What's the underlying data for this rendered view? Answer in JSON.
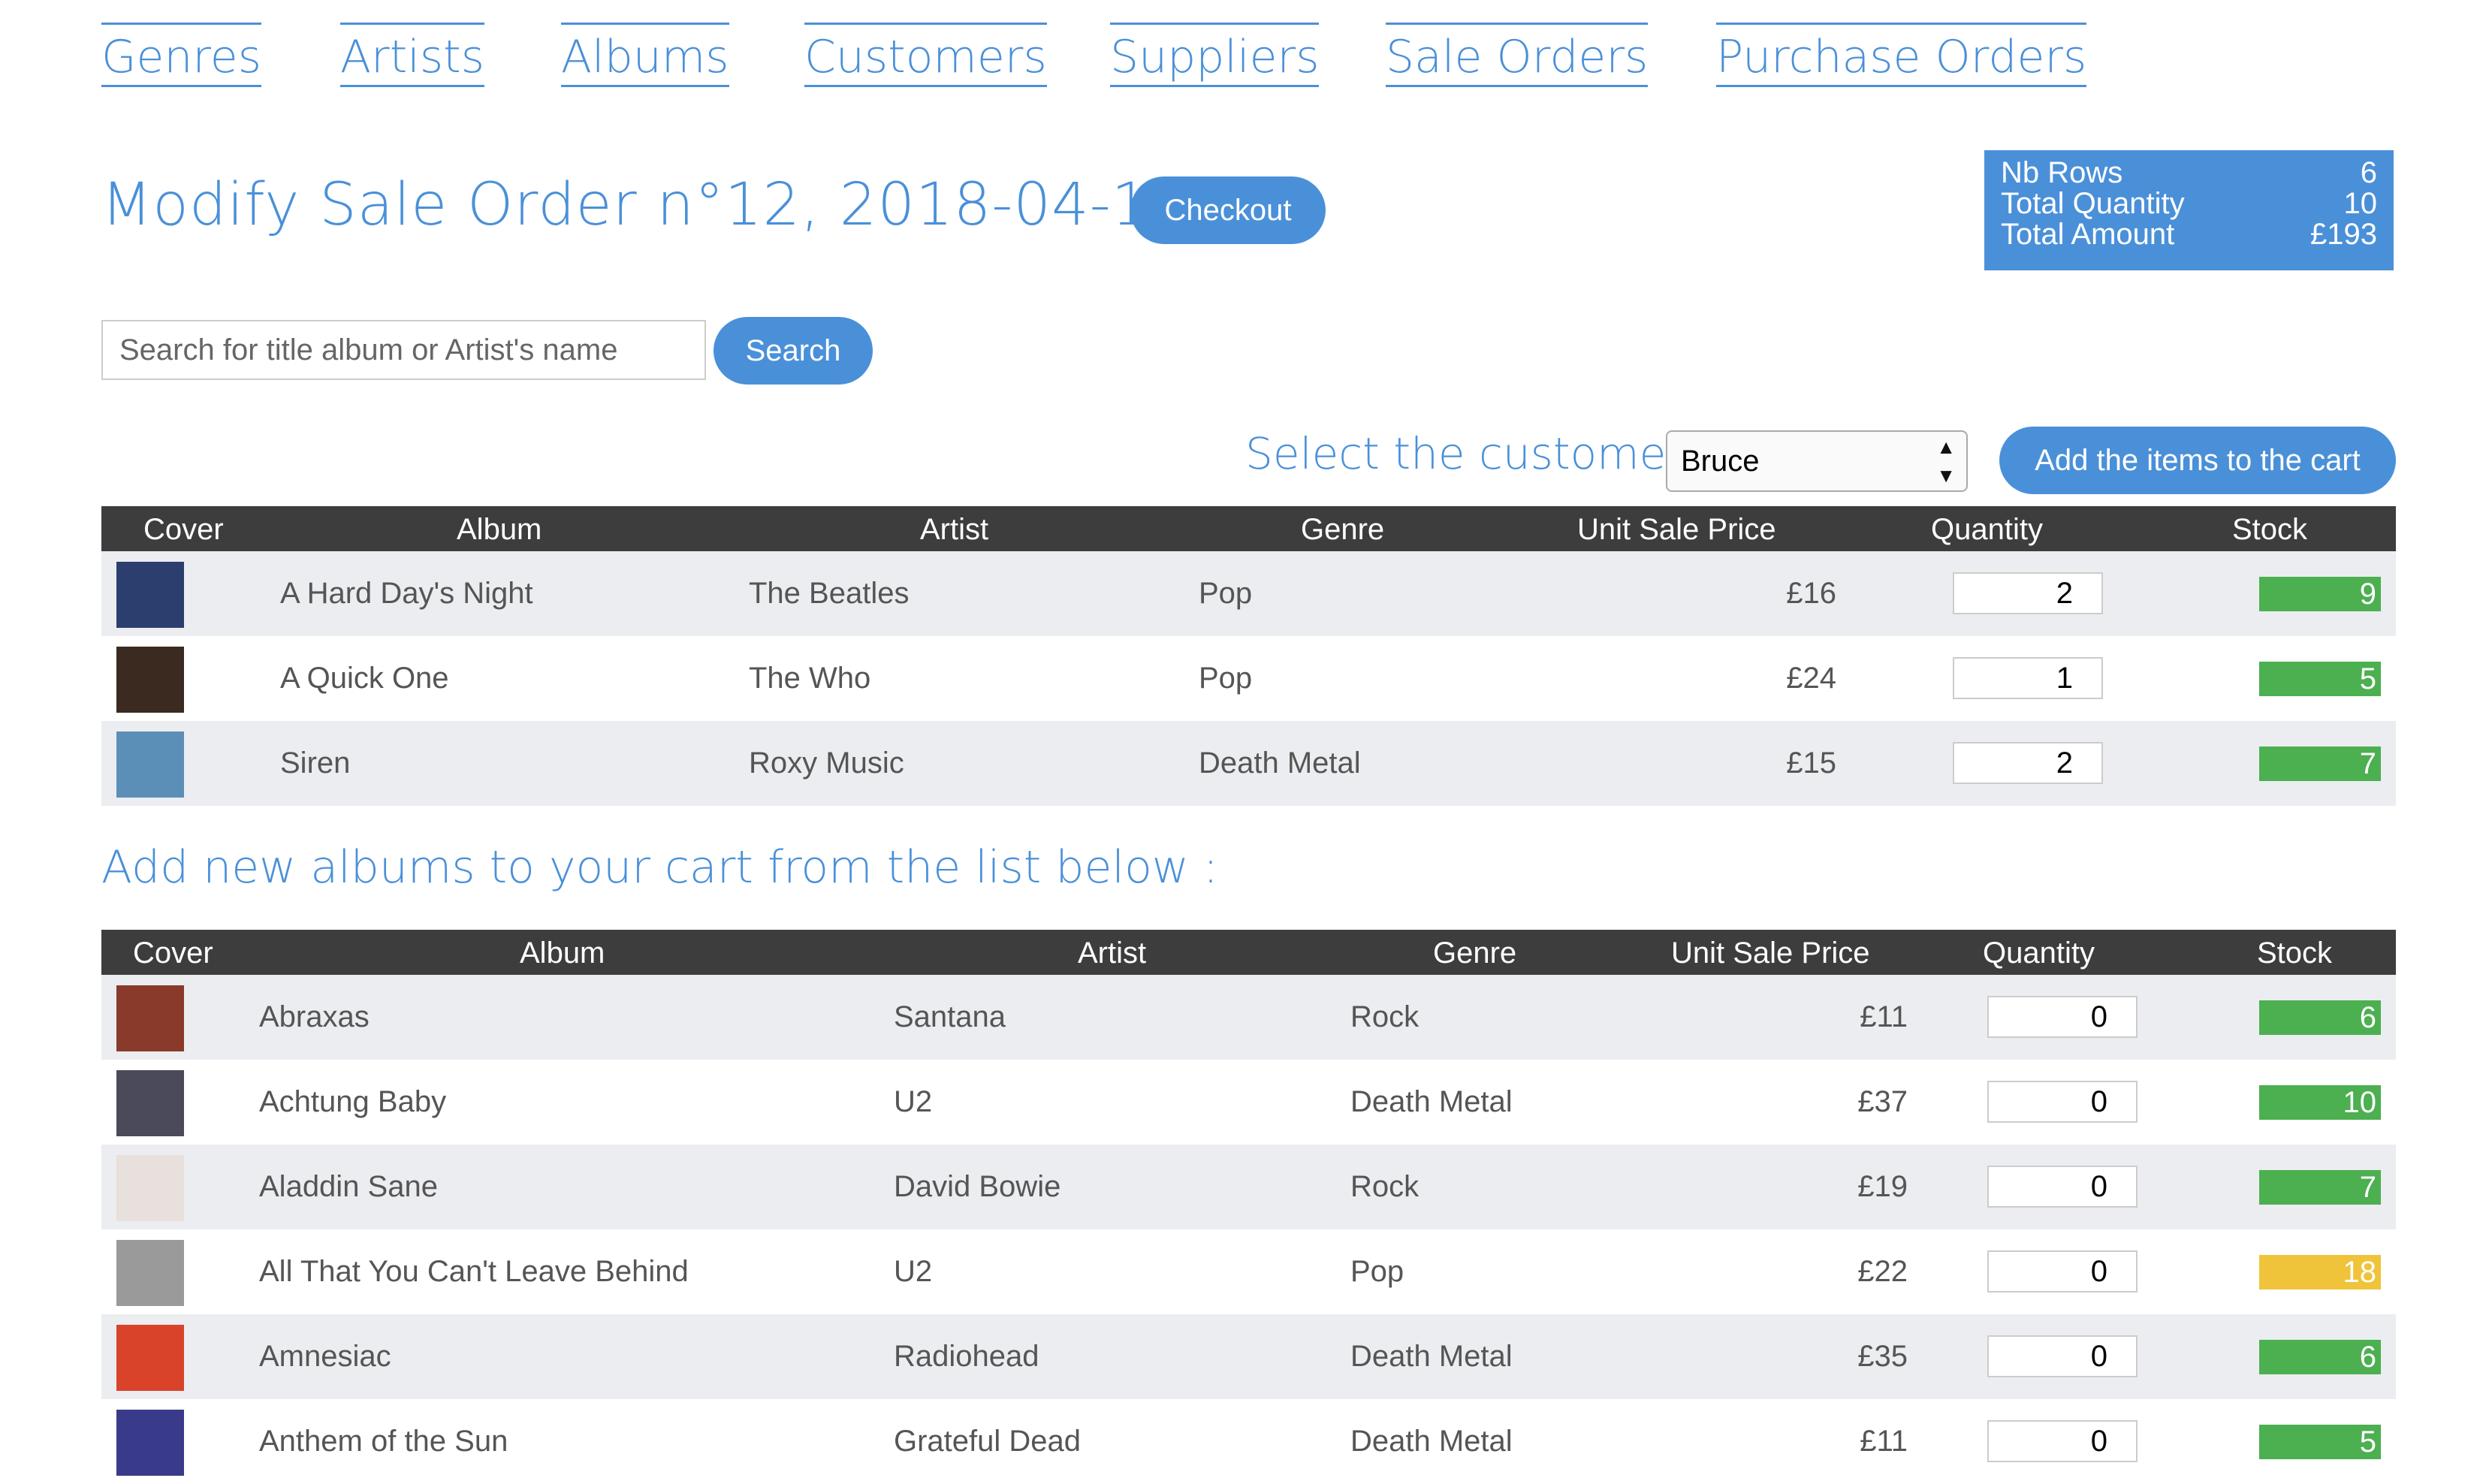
{
  "nav": [
    "Genres",
    "Artists",
    "Albums",
    "Customers",
    "Suppliers",
    "Sale Orders",
    "Purchase Orders"
  ],
  "title": "Modify Sale Order n°12, 2018-04-12",
  "checkout_label": "Checkout",
  "summary": {
    "rows": [
      {
        "label": "Nb Rows",
        "value": "6"
      },
      {
        "label": "Total Quantity",
        "value": "10"
      },
      {
        "label": "Total Amount",
        "value": "£193"
      }
    ]
  },
  "search": {
    "placeholder": "Search for title album or Artist's name",
    "button": "Search"
  },
  "customer": {
    "label": "Select the customer :",
    "selected": "Bruce",
    "add_button": "Add the items to the cart"
  },
  "columns": [
    "Cover",
    "Album",
    "Artist",
    "Genre",
    "Unit Sale Price",
    "Quantity",
    "Stock"
  ],
  "colors": {
    "accent": "#4a90d9",
    "header_bg": "#3d3d3d",
    "stock_ok": "#4caf50",
    "stock_warn": "#f0c43a"
  },
  "cart_rows": [
    {
      "album": "A Hard Day's Night",
      "artist": "The Beatles",
      "genre": "Pop",
      "price": "£16",
      "quantity": "2",
      "stock": "9",
      "stock_color": "#4caf50",
      "cover_color": "#2c3e6e"
    },
    {
      "album": "A Quick One",
      "artist": "The Who",
      "genre": "Pop",
      "price": "£24",
      "quantity": "1",
      "stock": "5",
      "stock_color": "#4caf50",
      "cover_color": "#3a2a20"
    },
    {
      "album": "Siren",
      "artist": "Roxy Music",
      "genre": "Death Metal",
      "price": "£15",
      "quantity": "2",
      "stock": "7",
      "stock_color": "#4caf50",
      "cover_color": "#5b8fb8"
    }
  ],
  "subheading": "Add new albums to your cart from the list below :",
  "album_rows": [
    {
      "album": "Abraxas",
      "artist": "Santana",
      "genre": "Rock",
      "price": "£11",
      "quantity": "0",
      "stock": "6",
      "stock_color": "#4caf50",
      "cover_color": "#8a3a2a"
    },
    {
      "album": "Achtung Baby",
      "artist": "U2",
      "genre": "Death Metal",
      "price": "£37",
      "quantity": "0",
      "stock": "10",
      "stock_color": "#4caf50",
      "cover_color": "#4a4a5a"
    },
    {
      "album": "Aladdin Sane",
      "artist": "David Bowie",
      "genre": "Rock",
      "price": "£19",
      "quantity": "0",
      "stock": "7",
      "stock_color": "#4caf50",
      "cover_color": "#e8e0dc"
    },
    {
      "album": "All That You Can't Leave Behind",
      "artist": "U2",
      "genre": "Pop",
      "price": "£22",
      "quantity": "0",
      "stock": "18",
      "stock_color": "#f0c43a",
      "cover_color": "#9a9a9a"
    },
    {
      "album": "Amnesiac",
      "artist": "Radiohead",
      "genre": "Death Metal",
      "price": "£35",
      "quantity": "0",
      "stock": "6",
      "stock_color": "#4caf50",
      "cover_color": "#d9432a"
    },
    {
      "album": "Anthem of the Sun",
      "artist": "Grateful Dead",
      "genre": "Death Metal",
      "price": "£11",
      "quantity": "0",
      "stock": "5",
      "stock_color": "#4caf50",
      "cover_color": "#3a3a8a"
    }
  ]
}
